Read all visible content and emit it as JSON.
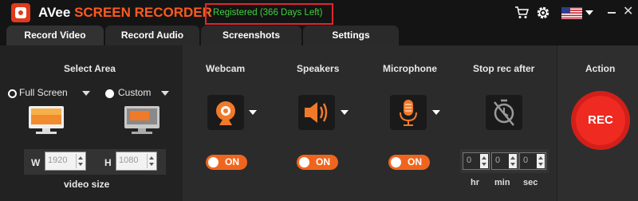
{
  "titlebar": {
    "app_name": "AVee",
    "app_name_accent": "SCREEN RECORDER",
    "registration_status": "- Registered (366 Days Left)",
    "minimize_symbol": "",
    "close_symbol": "✕"
  },
  "tabs": [
    {
      "label": "Record Video",
      "active": true
    },
    {
      "label": "Record Audio",
      "active": false
    },
    {
      "label": "Screenshots",
      "active": false
    },
    {
      "label": "Settings",
      "active": false
    }
  ],
  "select_area": {
    "title": "Select Area",
    "modes": [
      {
        "label": "Full Screen",
        "selected": true
      },
      {
        "label": "Custom",
        "selected": false
      }
    ],
    "width_label": "W",
    "width_value": "1920",
    "height_label": "H",
    "height_value": "1080",
    "size_caption": "video size"
  },
  "devices": [
    {
      "title": "Webcam",
      "icon": "webcam-icon",
      "toggle": "ON"
    },
    {
      "title": "Speakers",
      "icon": "speaker-icon",
      "toggle": "ON"
    },
    {
      "title": "Microphone",
      "icon": "microphone-icon",
      "toggle": "ON"
    }
  ],
  "stop_rec": {
    "title": "Stop rec after",
    "hours": "0",
    "minutes": "0",
    "seconds": "0",
    "hour_label": "hr",
    "minute_label": "min",
    "second_label": "sec"
  },
  "action": {
    "title": "Action",
    "rec_label": "REC"
  },
  "colors": {
    "accent": "#ff5a1f",
    "registered": "#3ed23e",
    "highlight_box": "#e0262e",
    "rec": "#ee2a21"
  }
}
